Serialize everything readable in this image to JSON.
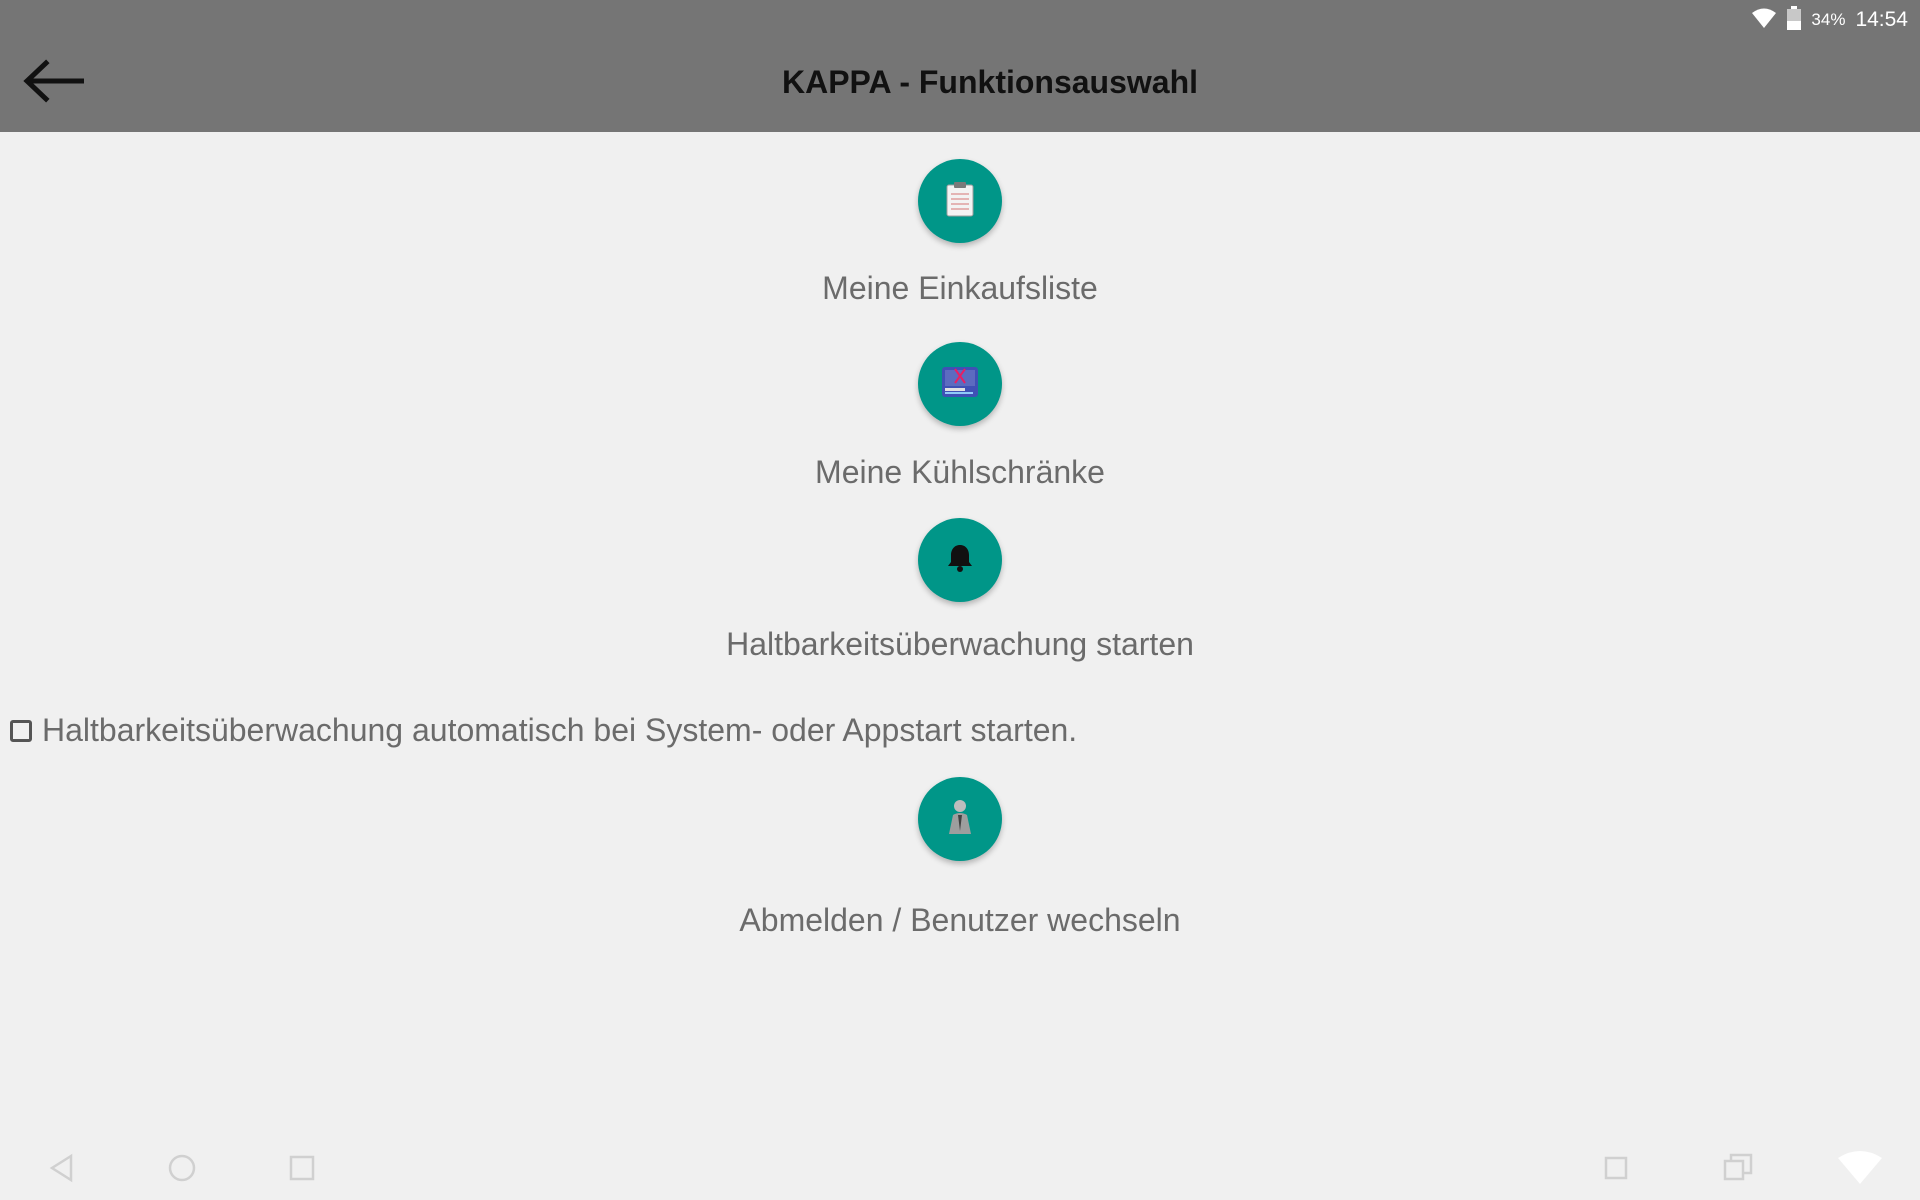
{
  "status_bar": {
    "battery_percent": "34%",
    "time": "14:54",
    "icons": [
      "wifi-icon",
      "battery-icon"
    ]
  },
  "app_bar": {
    "title": "KAPPA - Funktionsauswahl",
    "back_icon": "arrow-left-icon"
  },
  "menu": {
    "items": [
      {
        "label": "Meine Einkaufsliste",
        "icon": "clipboard-icon"
      },
      {
        "label": "Meine Kühlschränke",
        "icon": "fridge-icon"
      },
      {
        "label": "Haltbarkeitsüberwachung starten",
        "icon": "bell-icon"
      },
      {
        "label": "Abmelden / Benutzer wechseln",
        "icon": "user-icon"
      }
    ],
    "auto_start_checkbox": {
      "label": "Haltbarkeitsüberwachung automatisch bei System- oder Appstart starten.",
      "checked": false
    }
  },
  "nav_bar": {
    "icons": [
      "nav-back-icon",
      "nav-home-icon",
      "nav-recents-icon",
      "screenshot-icon",
      "multiwindow-icon",
      "wifi-nav-icon"
    ]
  },
  "colors": {
    "app_bar": "#757575",
    "accent": "#009688",
    "background": "#f0f0f0",
    "label_text": "#6b6b6b"
  }
}
